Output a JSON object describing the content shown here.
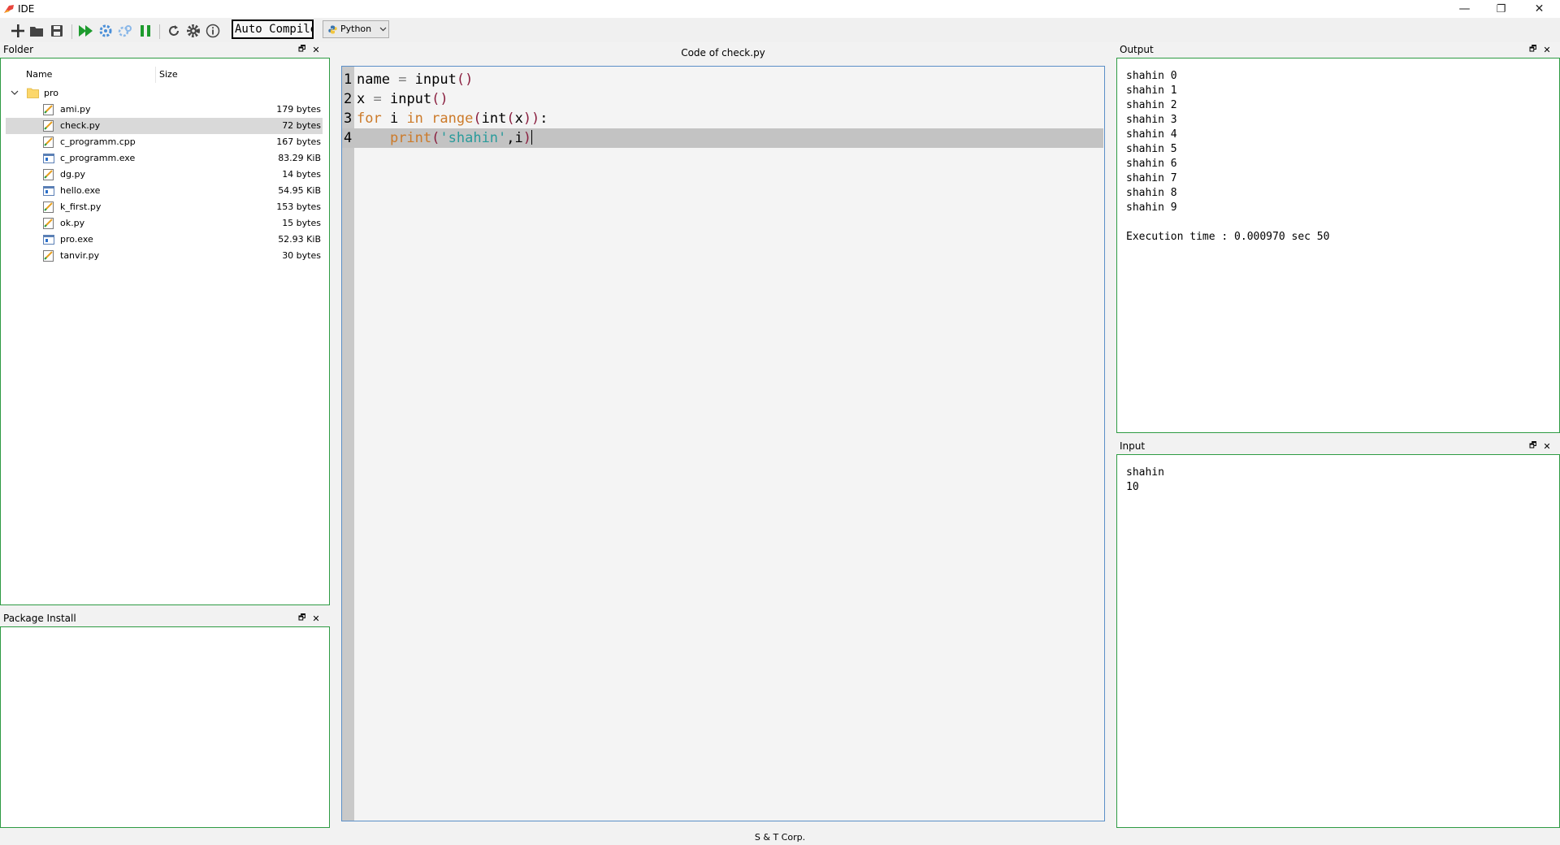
{
  "window": {
    "title": "IDE",
    "controls": {
      "minimize": "—",
      "maximize": "❐",
      "close": "✕"
    }
  },
  "toolbar": {
    "icons": [
      "new-file-icon",
      "open-folder-icon",
      "save-icon",
      "run-icon",
      "debug-icon",
      "debug-step-icon",
      "pause-icon",
      "refresh-icon",
      "settings-icon",
      "info-icon"
    ],
    "auto_compile_label": "Auto Compile",
    "language": "Python",
    "colors": {
      "run": "#1e9b2e",
      "debug": "#4a8fd8",
      "pause": "#1e9b2e"
    }
  },
  "folder_panel": {
    "title": "Folder",
    "columns": {
      "name": "Name",
      "size": "Size"
    },
    "root": "pro",
    "files": [
      {
        "name": "ami.py",
        "size": "179 bytes",
        "type": "py"
      },
      {
        "name": "check.py",
        "size": "72 bytes",
        "type": "py",
        "selected": true
      },
      {
        "name": "c_programm.cpp",
        "size": "167 bytes",
        "type": "py"
      },
      {
        "name": "c_programm.exe",
        "size": "83.29 KiB",
        "type": "exe"
      },
      {
        "name": "dg.py",
        "size": "14 bytes",
        "type": "py"
      },
      {
        "name": "hello.exe",
        "size": "54.95 KiB",
        "type": "exe"
      },
      {
        "name": "k_first.py",
        "size": "153 bytes",
        "type": "py"
      },
      {
        "name": "ok.py",
        "size": "15 bytes",
        "type": "py"
      },
      {
        "name": "pro.exe",
        "size": "52.93 KiB",
        "type": "exe"
      },
      {
        "name": "tanvir.py",
        "size": "30 bytes",
        "type": "py"
      }
    ]
  },
  "package_panel": {
    "title": "Package Install"
  },
  "editor": {
    "title": "Code of check.py",
    "lines": [
      {
        "number": "1"
      },
      {
        "number": "2"
      },
      {
        "number": "3"
      },
      {
        "number": "4",
        "current": true
      }
    ],
    "line1": {
      "a": "name",
      "b": " = ",
      "c": "input",
      "d": "()"
    },
    "line2": {
      "a": "x",
      "b": " = ",
      "c": "input",
      "d": "()"
    },
    "line3": {
      "kw1": "for",
      "a": " i ",
      "kw2": "in",
      "fn": " range",
      "p1": "(",
      "b": "int",
      "p2": "(",
      "c": "x",
      "p3": "))",
      "d": ":"
    },
    "line4": {
      "indent": "    ",
      "fn": "print",
      "p1": "(",
      "str": "'shahin'",
      "a": ",i",
      "p2": ")"
    }
  },
  "output_panel": {
    "title": "Output",
    "text": "shahin 0\nshahin 1\nshahin 2\nshahin 3\nshahin 4\nshahin 5\nshahin 6\nshahin 7\nshahin 8\nshahin 9\n\nExecution time : 0.000970 sec 50"
  },
  "input_panel": {
    "title": "Input",
    "text": "shahin\n10"
  },
  "footer": {
    "text": "S & T Corp."
  },
  "dock_controls": {
    "float": "🗗",
    "close": "✕"
  }
}
